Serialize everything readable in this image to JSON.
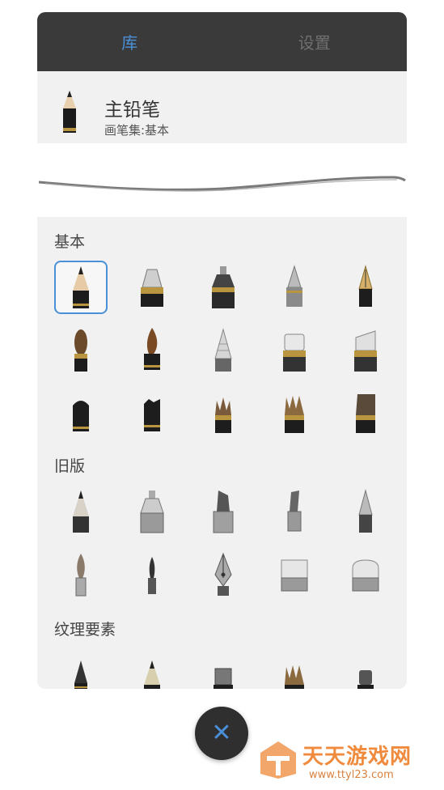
{
  "tabs": [
    {
      "label": "库",
      "active": true
    },
    {
      "label": "设置",
      "active": false
    }
  ],
  "current_brush": {
    "name": "主铅笔",
    "set": "画笔集:基本"
  },
  "sections": [
    {
      "title": "基本"
    },
    {
      "title": "旧版"
    },
    {
      "title": "纹理要素"
    }
  ],
  "colors": {
    "accent": "#4a90d9",
    "tabbar": "#3a3a3a",
    "panel": "#f1f1f1",
    "watermark": "#f08a3c"
  },
  "fab": {
    "icon": "close-icon",
    "glyph": "✕"
  },
  "watermark": {
    "text": "天天游戏网",
    "url": "www.ttyl23.com"
  }
}
